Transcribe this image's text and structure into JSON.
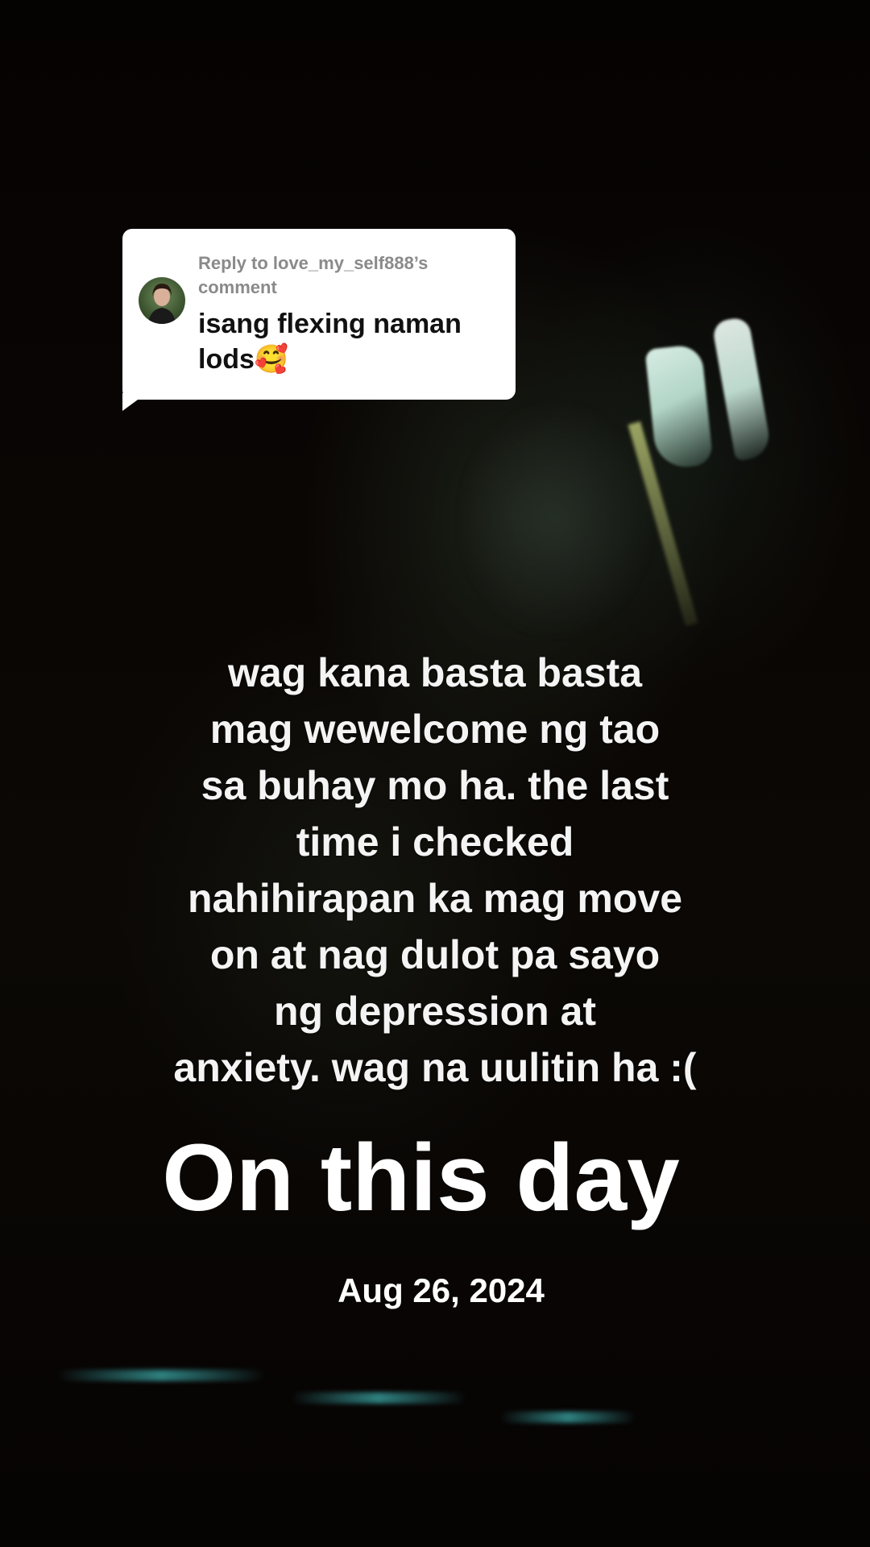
{
  "reply_bubble": {
    "header": "Reply to love_my_self888’s comment",
    "comment": "isang flexing naman lods🥰"
  },
  "caption": "wag kana basta basta\nmag wewelcome ng tao\nsa buhay mo ha. the last\ntime i checked\nnahihirapan ka mag move\non at nag dulot pa sayo\nng depression at\nanxiety. wag na uulitin ha :(",
  "memory": {
    "label": "On this day",
    "date": "Aug 26, 2024"
  },
  "icons": {
    "avatar": "commenter-avatar"
  },
  "colors": {
    "background": "#060202",
    "bubble": "#ffffff",
    "bubble_header_text": "#8a8a8a",
    "bubble_body_text": "#111111",
    "overlay_text": "#ffffff"
  }
}
